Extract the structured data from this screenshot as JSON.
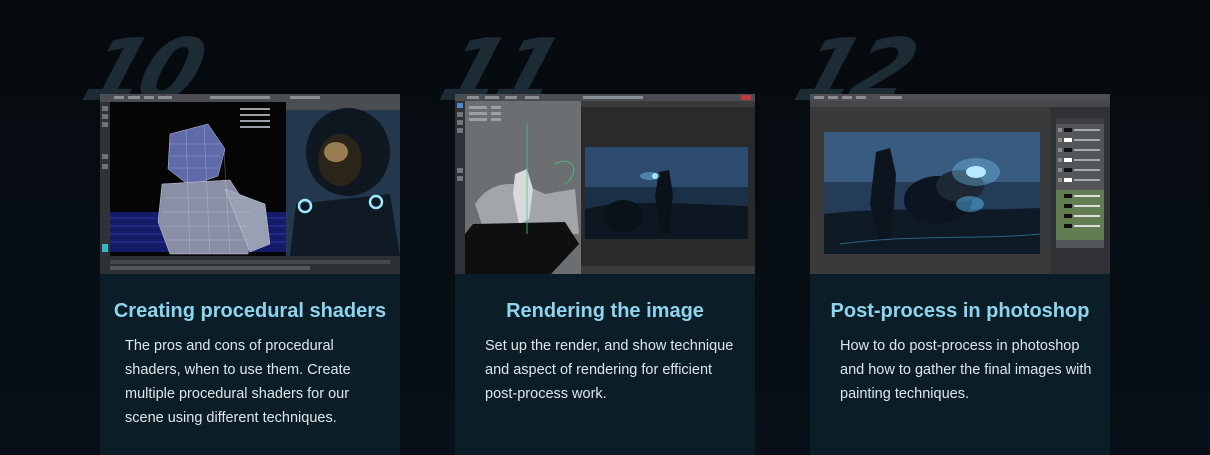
{
  "steps": [
    {
      "number": "10",
      "title": "Creating procedural shaders",
      "description": "The pros and cons of procedural shaders, when to use them. Create multiple procedural shaders for our scene using different techniques.",
      "thumbnail": "maya-wireframe-and-helmet-render"
    },
    {
      "number": "11",
      "title": "Rendering the image",
      "description": "Set up the render, and show technique and aspect of rendering for efficient post-process work.",
      "thumbnail": "maya-render-view-astronaut-scene"
    },
    {
      "number": "12",
      "title": "Post-process in photoshop",
      "description": "How to do post-process in photoshop and how to gather the final images with painting techniques.",
      "thumbnail": "photoshop-final-astronaut-image"
    }
  ],
  "colors": {
    "background": "#05090d",
    "card": "#0b1d27",
    "title": "#8fd4ee",
    "text": "#dfe6ea",
    "number": "#1d2b35"
  }
}
